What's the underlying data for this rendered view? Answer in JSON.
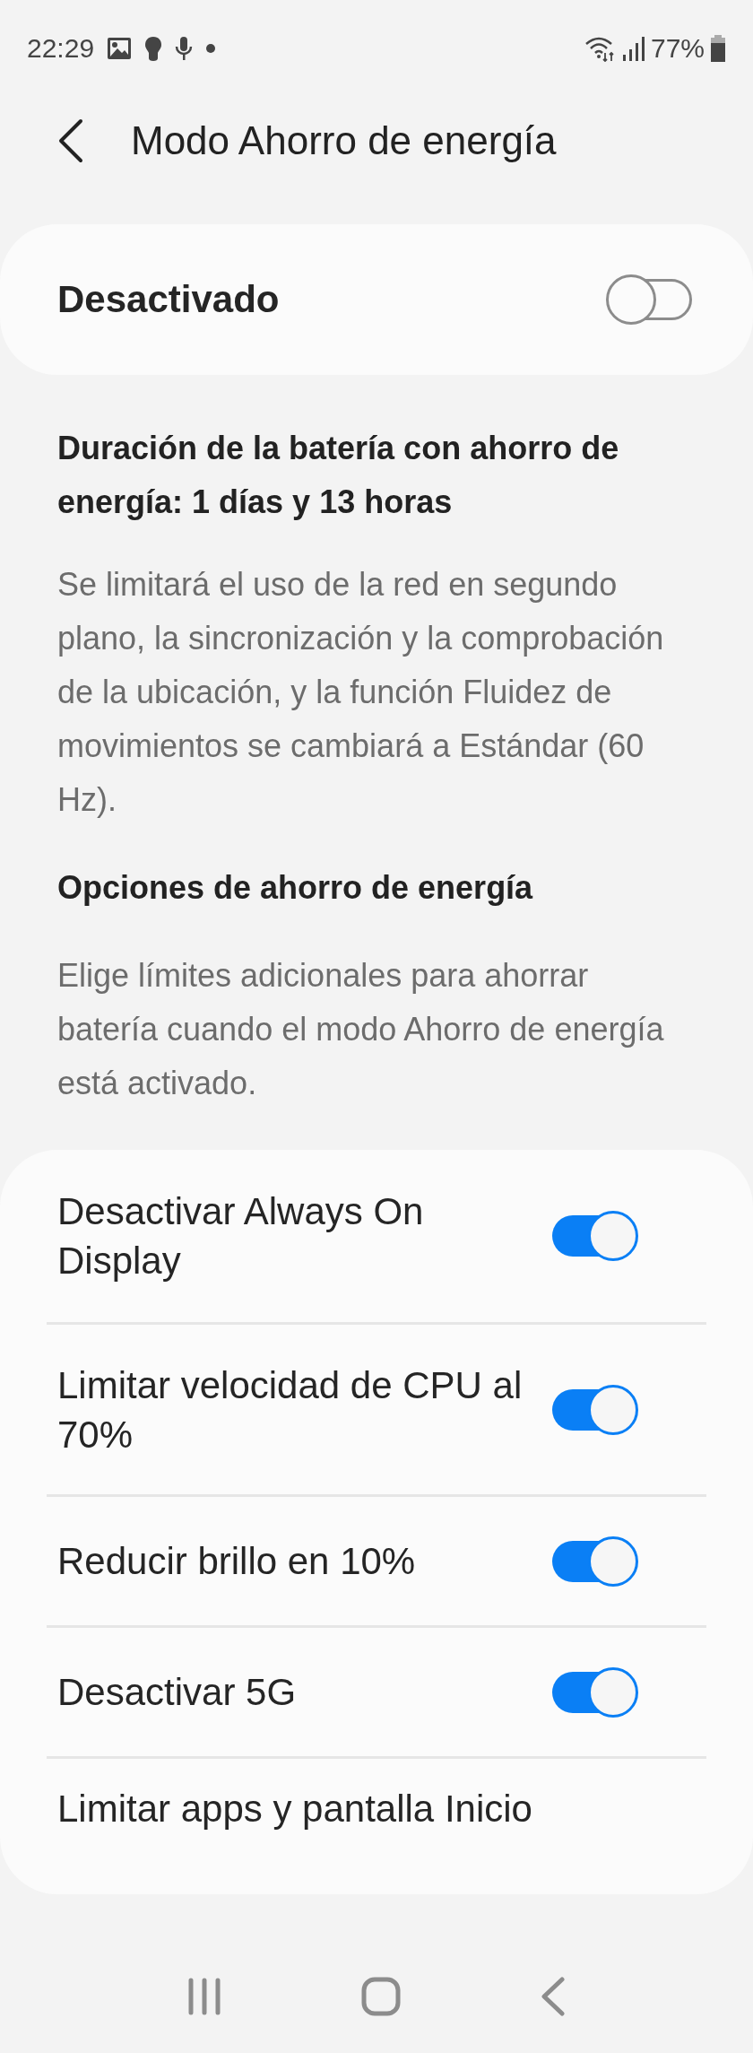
{
  "status_bar": {
    "time": "22:29",
    "battery": "77%"
  },
  "header": {
    "title": "Modo Ahorro de energía"
  },
  "master": {
    "label": "Desactivado",
    "on": false
  },
  "duration": "Duración de la batería con ahorro de energía: 1 días y 13 horas",
  "description": "Se limitará el uso de la red en segundo plano, la sincronización y la comprobación de la ubicación, y la función Fluidez de movimientos se cambiará a Estándar (60 Hz).",
  "options_title": "Opciones de ahorro de energía",
  "options_description": "Elige límites adicionales para ahorrar batería cuando el modo Ahorro de energía está activado.",
  "options": [
    {
      "kind": "switch",
      "label": "Desactivar Always On Display",
      "on": true
    },
    {
      "kind": "switch",
      "label": "Limitar velocidad de CPU al 70%",
      "on": true
    },
    {
      "kind": "switch",
      "label": "Reducir brillo en 10%",
      "on": true
    },
    {
      "kind": "switch",
      "label": "Desactivar 5G",
      "on": true
    },
    {
      "kind": "link",
      "label": "Limitar apps y pantalla Inicio"
    }
  ]
}
